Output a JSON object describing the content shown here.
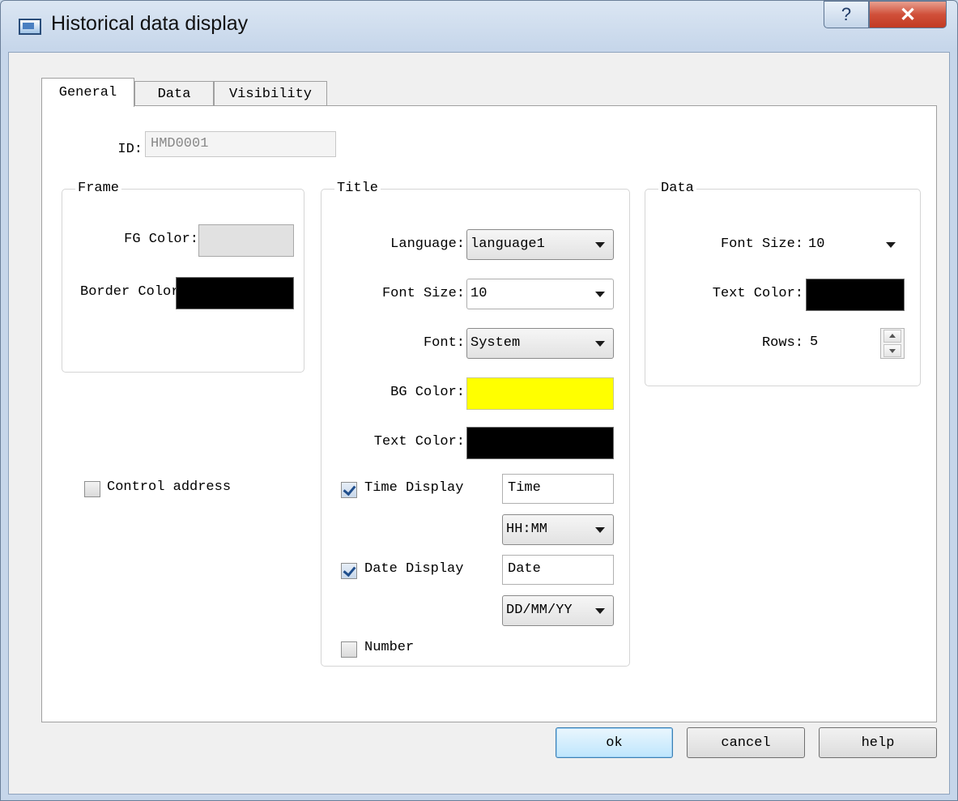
{
  "window": {
    "title": "Historical data display",
    "help_glyph": "?",
    "close_glyph": "✕"
  },
  "tabs": [
    {
      "label": "General"
    },
    {
      "label": "Data"
    },
    {
      "label": "Visibility"
    }
  ],
  "id_field": {
    "label": "ID:",
    "value": "HMD0001"
  },
  "frame": {
    "title": "Frame",
    "fg_color_label": "FG Color:",
    "fg_color": "#e1e1e1",
    "border_color_label": "Border Color",
    "border_color": "#000000"
  },
  "control_address": {
    "label": "Control address",
    "checked": false
  },
  "title_group": {
    "title": "Title",
    "language_label": "Language:",
    "language_value": "language1",
    "font_size_label": "Font Size:",
    "font_size_value": "10",
    "font_label": "Font:",
    "font_value": "System",
    "bg_color_label": "BG Color:",
    "bg_color": "#ffff00",
    "text_color_label": "Text Color:",
    "text_color": "#000000",
    "time_display_label": "Time Display",
    "time_display_checked": true,
    "time_text": "Time",
    "time_format": "HH:MM",
    "date_display_label": "Date Display",
    "date_display_checked": true,
    "date_text": "Date",
    "date_format": "DD/MM/YY",
    "number_label": "Number",
    "number_checked": false
  },
  "data_group": {
    "title": "Data",
    "font_size_label": "Font Size:",
    "font_size_value": "10",
    "text_color_label": "Text Color:",
    "text_color": "#000000",
    "rows_label": "Rows:",
    "rows_value": "5"
  },
  "buttons": {
    "ok": "ok",
    "cancel": "cancel",
    "help": "help"
  }
}
